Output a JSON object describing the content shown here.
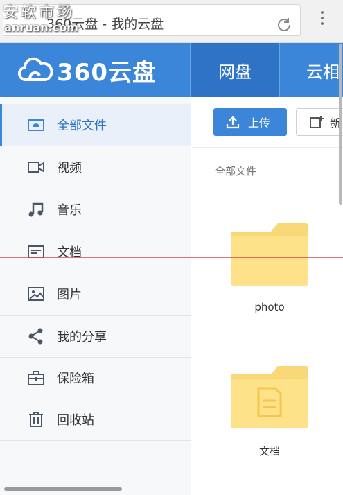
{
  "watermark": {
    "text": "安软市场",
    "url": "anruan.com"
  },
  "browser": {
    "tab_title": "360云盘 - 我的云盘"
  },
  "header": {
    "logo_text": "360云盘",
    "tabs": [
      {
        "label": "网盘"
      },
      {
        "label": "云相"
      }
    ]
  },
  "sidebar": {
    "items": [
      {
        "label": "全部文件",
        "icon": "all-files-icon"
      },
      {
        "label": "视频",
        "icon": "video-icon"
      },
      {
        "label": "音乐",
        "icon": "music-icon"
      },
      {
        "label": "文档",
        "icon": "document-icon"
      },
      {
        "label": "图片",
        "icon": "image-icon"
      },
      {
        "label": "我的分享",
        "icon": "share-icon"
      },
      {
        "label": "保险箱",
        "icon": "safe-icon"
      },
      {
        "label": "回收站",
        "icon": "trash-icon"
      }
    ]
  },
  "toolbar": {
    "upload_label": "上传",
    "new_label": "新"
  },
  "breadcrumb": "全部文件",
  "files": [
    {
      "name": "photo",
      "type": "folder"
    },
    {
      "name": "文档",
      "type": "document-folder"
    }
  ],
  "colors": {
    "brand_blue": "#3c86d9",
    "active_blue": "#2f73c6",
    "folder_yellow": "#fde28a"
  }
}
